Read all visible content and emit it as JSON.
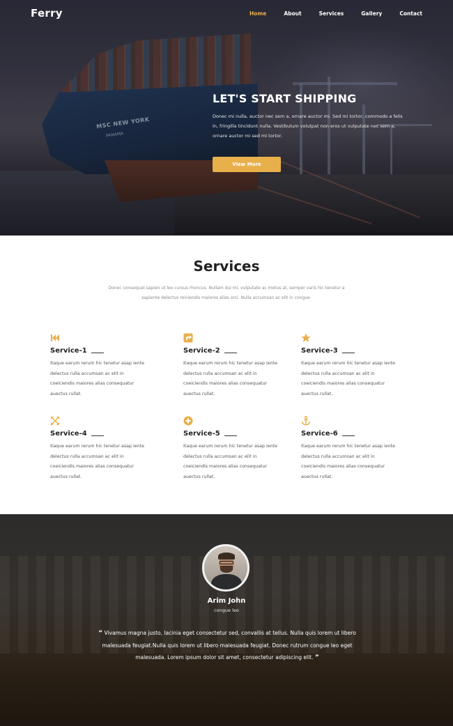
{
  "brand": {
    "logo": "Ferry",
    "accent_color": "#e8b04b"
  },
  "nav": {
    "items": [
      {
        "label": "Home",
        "active": true
      },
      {
        "label": "About",
        "active": false
      },
      {
        "label": "Services",
        "active": false
      },
      {
        "label": "Gallery",
        "active": false
      },
      {
        "label": "Contact",
        "active": false
      }
    ]
  },
  "hero": {
    "title": "LET'S START SHIPPING",
    "description": "Donec mi nulla, auctor nec sem a, ornare auctor mi. Sed mi tortor, commodo a felis in, fringilla tincidunt nulla. Vestibulum volutpat non eros ut vulputate nec sem a, ornare auctor mi sed mi tortor.",
    "button_label": "View More",
    "ship_name": "MSC NEW YORK",
    "ship_port": "PANAMA"
  },
  "services": {
    "title": "Services",
    "description": "Donec consequat sapien ut leo cursus rhoncus. Nullam dui mi, vulputate ac metus at, semper varis hic tenetur a sapiente delectus reiciendis maiores alias orci. Nulla accumsan ac elit in congue.",
    "items": [
      {
        "title": "Service-1",
        "icon": "rewind-icon",
        "text": "Itaque earum rerum hic tenetur asap iente delectus rulla accumsan ac elit in coeiciendis maiores alias consequatur auectus rullat."
      },
      {
        "title": "Service-2",
        "icon": "share-square-icon",
        "text": "Itaque earum rerum hic tenetur asap iente delectus rulla accumsan ac elit in coeiciendis maiores alias consequatur auectus rullat."
      },
      {
        "title": "Service-3",
        "icon": "star-icon",
        "text": "Itaque earum rerum hic tenetur asap iente delectus rulla accumsan ac elit in coeiciendis maiores alias consequatur auectus rullat."
      },
      {
        "title": "Service-4",
        "icon": "expand-arrows-icon",
        "text": "Itaque earum rerum hic tenetur asap iente delectus rulla accumsan ac elit in coeiciendis maiores alias consequatur auectus rullat."
      },
      {
        "title": "Service-5",
        "icon": "plus-circle-icon",
        "text": "Itaque earum rerum hic tenetur asap iente delectus rulla accumsan ac elit in coeiciendis maiores alias consequatur auectus rullat."
      },
      {
        "title": "Service-6",
        "icon": "anchor-icon",
        "text": "Itaque earum rerum hic tenetur asap iente delectus rulla accumsan ac elit in coeiciendis maiores alias consequatur auectus rullat."
      }
    ]
  },
  "testimonial": {
    "name": "Arim John",
    "role": "congue leo",
    "quote": "Vivamus magna justo, lacinia eget consectetur sed, convallis at tellus. Nulla quis lorem ut libero malesuada feugiat.Nulla quis lorem ut libero malesuada feugiat. Donec rutrum congue leo eget malesuada. Lorem ipsum dolor sit amet, consectetur adipiscing elit.",
    "open_quote": "“",
    "close_quote": "”"
  }
}
